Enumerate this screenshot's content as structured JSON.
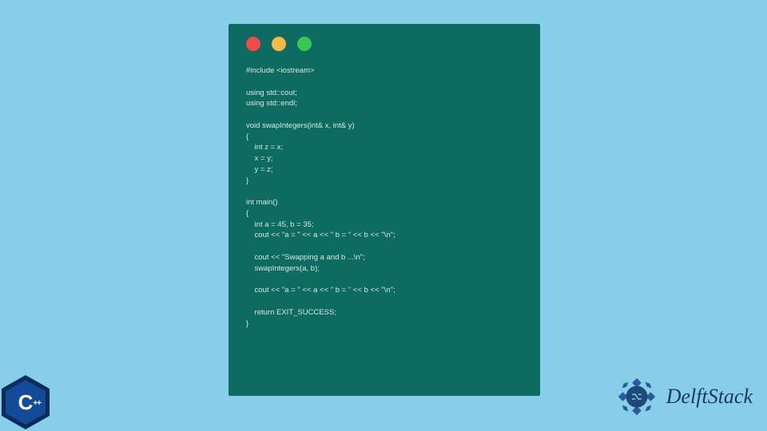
{
  "window": {
    "dots": [
      "red",
      "yellow",
      "green"
    ]
  },
  "code": {
    "lines": "#include <iostream>\n\nusing std::cout;\nusing std::endl;\n\nvoid swapIntegers(int& x, int& y)\n{\n    int z = x;\n    x = y;\n    y = z;\n}\n\nint main()\n{\n    int a = 45, b = 35;\n    cout << \"a = \" << a << \" b = \" << b << \"\\n\";\n\n    cout << \"Swapping a and b ...\\n\";\n    swapIntegers(a, b);\n\n    cout << \"a = \" << a << \" b = \" << b << \"\\n\";\n\n    return EXIT_SUCCESS;\n}"
  },
  "cpp_badge": {
    "letter": "C",
    "suffix": "++"
  },
  "brand": {
    "text": "DelftStack"
  }
}
